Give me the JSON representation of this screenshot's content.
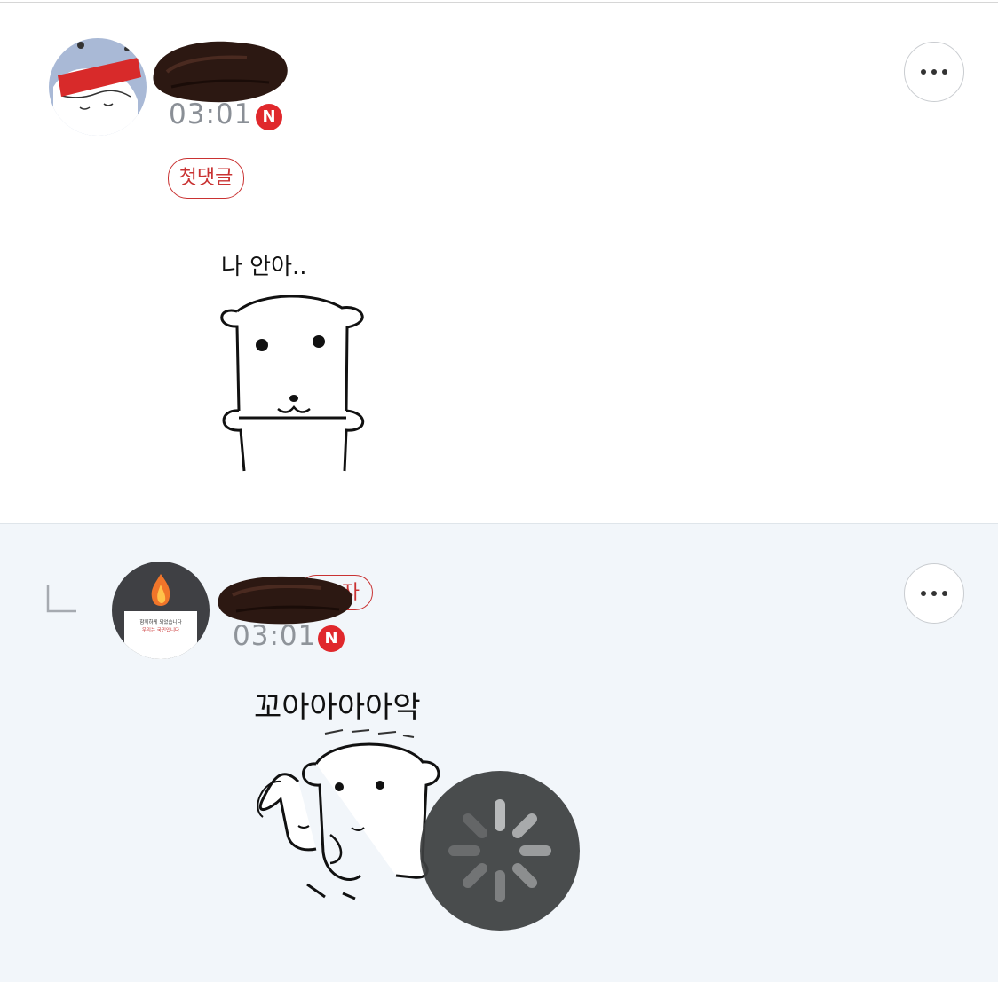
{
  "comments": [
    {
      "time": "03:01",
      "new_badge": "N",
      "first_comment_badge": "첫댓글",
      "sticker_text": "나 안아..",
      "more_icon": "more-horizontal-icon"
    },
    {
      "time": "03:01",
      "new_badge": "N",
      "author_badge_partial": "자",
      "avatar_text_1": "함께하게 되었습니다",
      "avatar_text_2": "우리는 국민입니다",
      "sticker_text": "꼬아아아아악",
      "more_icon": "more-horizontal-icon"
    }
  ],
  "colors": {
    "accent_red": "#c93232",
    "reply_background": "#f2f6fa",
    "time_gray": "#8a8f96"
  },
  "loading_icon": "loading-spinner-icon"
}
